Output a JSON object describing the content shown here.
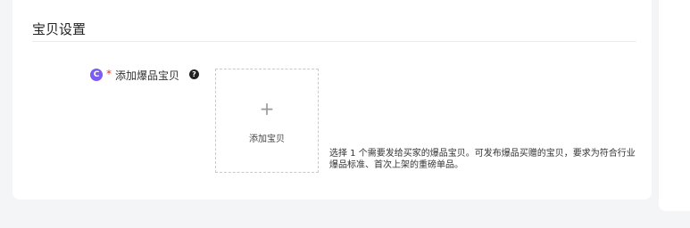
{
  "section": {
    "title": "宝贝设置"
  },
  "field": {
    "badge": "C",
    "required_mark": "*",
    "label": "添加爆品宝贝",
    "help_icon": "question-circle-icon"
  },
  "upload": {
    "plus_icon": "+",
    "label": "添加宝贝"
  },
  "helper_text": "选择 1 个需要发给买家的爆品宝贝。可发布爆品买赠的宝贝，要求为符合行业爆品标准、首次上架的重磅单品。",
  "colors": {
    "badge": "#7b5cf5",
    "required": "#e5322d",
    "background": "#f4f5f7"
  }
}
